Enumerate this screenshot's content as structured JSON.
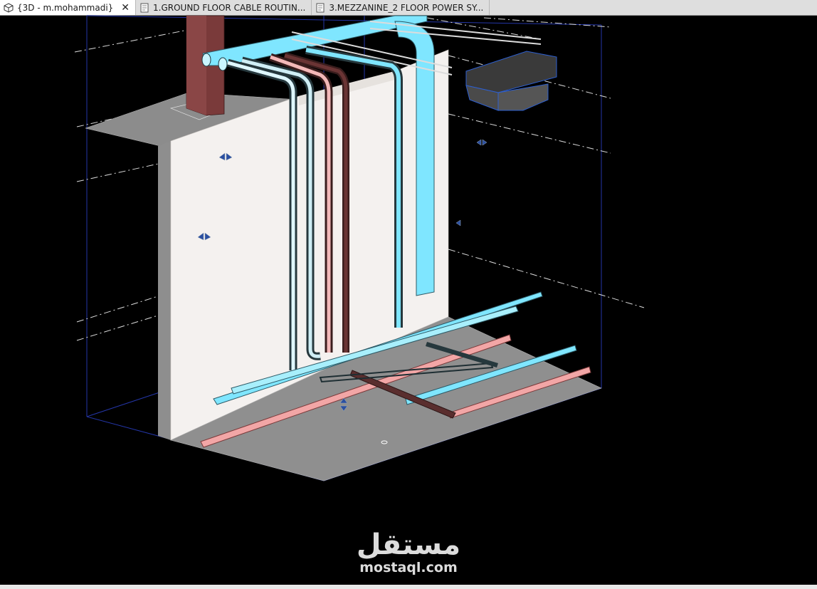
{
  "tabs": [
    {
      "label": "{3D - m.mohammadi}",
      "icon": "3d-view-icon",
      "close": "✕",
      "active": true
    },
    {
      "label": "1.GROUND FLOOR CABLE ROUTIN...",
      "icon": "floor-plan-icon",
      "active": false
    },
    {
      "label": "3.MEZZANINE_2 FLOOR POWER SY...",
      "icon": "floor-plan-icon",
      "active": false
    }
  ],
  "watermark": {
    "arabic": "مستقل",
    "latin": "mostaql.com"
  },
  "colors": {
    "background": "#000000",
    "wall": "#f4f1ef",
    "wall_side": "#8e8e8e",
    "floor": "#909090",
    "duct_blue": "#7fe6ff",
    "conduit_pink": "#f2a6a6",
    "conduit_brown": "#5a2e2e",
    "column": "#7a3a3a",
    "grid_line": "#2a3a9a"
  }
}
